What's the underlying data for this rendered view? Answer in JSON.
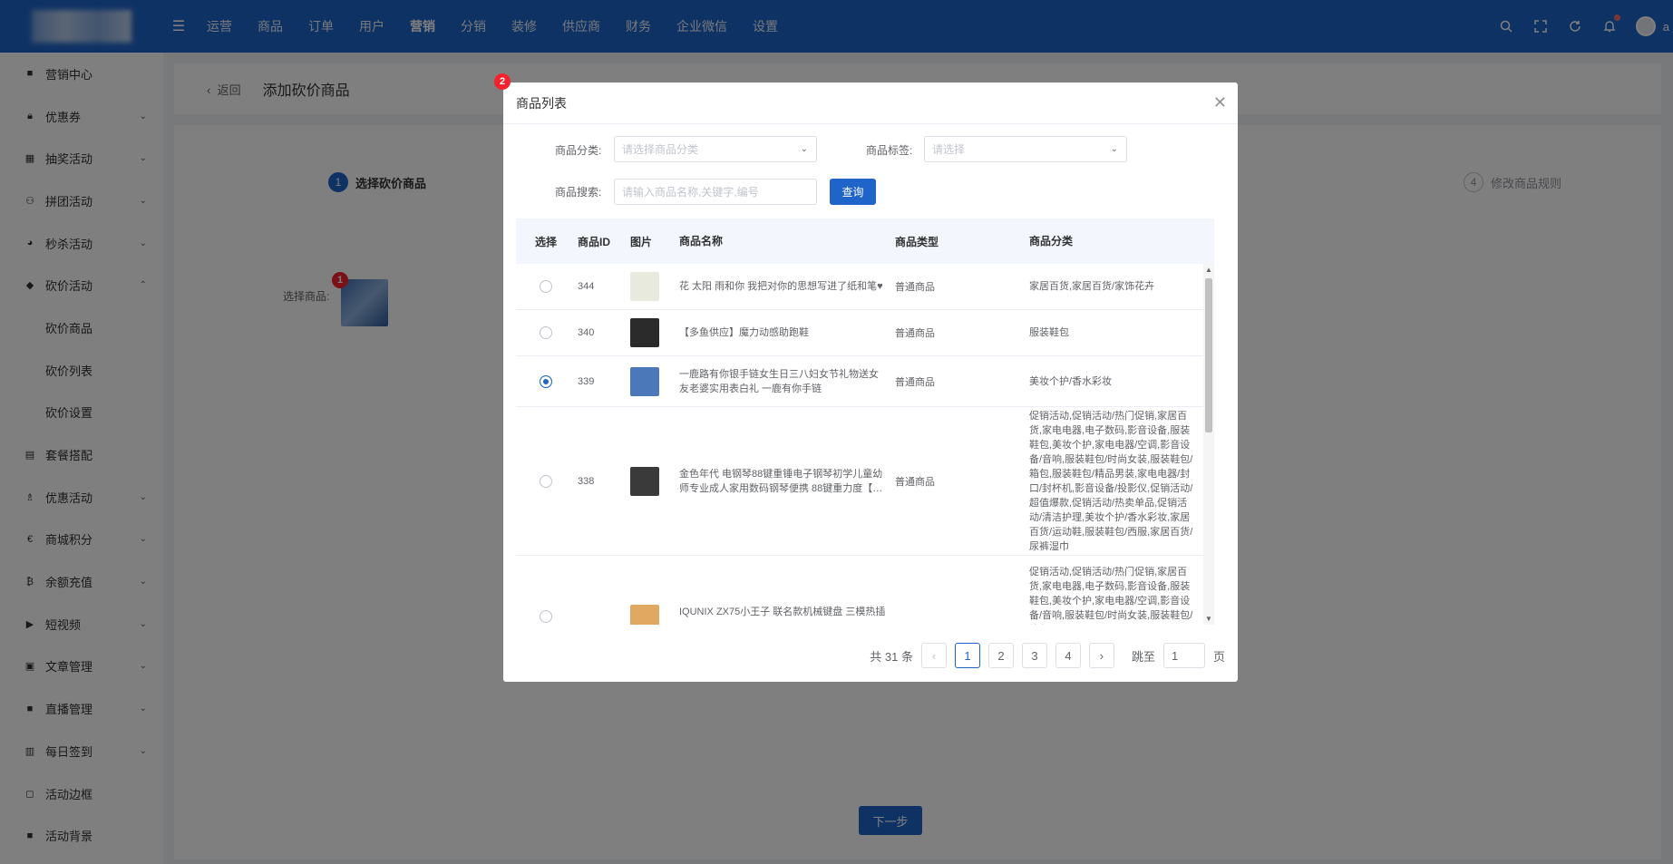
{
  "topbar": {
    "nav": [
      "运营",
      "商品",
      "订单",
      "用户",
      "营销",
      "分销",
      "装修",
      "供应商",
      "财务",
      "企业微信",
      "设置"
    ],
    "active_nav": "营销",
    "user_initial": "a"
  },
  "sidebar": {
    "items": [
      {
        "label": "营销中心",
        "icon": "home-icon"
      },
      {
        "label": "优惠券",
        "icon": "lock-icon"
      },
      {
        "label": "抽奖活动",
        "icon": "grid-icon"
      },
      {
        "label": "拼团活动",
        "icon": "group-icon"
      },
      {
        "label": "秒杀活动",
        "icon": "clock-icon"
      },
      {
        "label": "砍价活动",
        "icon": "tag-icon"
      }
    ],
    "sub_items": [
      "砍价商品",
      "砍价列表",
      "砍价设置"
    ],
    "items_after": [
      {
        "label": "套餐搭配",
        "icon": "package-icon"
      },
      {
        "label": "优惠活动",
        "icon": "gift-icon"
      },
      {
        "label": "商城积分",
        "icon": "euro-icon"
      },
      {
        "label": "余额充值",
        "icon": "bitcoin-icon"
      },
      {
        "label": "短视频",
        "icon": "video-icon"
      },
      {
        "label": "文章管理",
        "icon": "doc-icon"
      },
      {
        "label": "直播管理",
        "icon": "camera-icon"
      },
      {
        "label": "每日签到",
        "icon": "calendar-icon"
      },
      {
        "label": "活动边框",
        "icon": "frame-icon"
      },
      {
        "label": "活动背景",
        "icon": "square-icon"
      }
    ]
  },
  "page": {
    "back": "返回",
    "title": "添加砍价商品",
    "steps": [
      {
        "num": "1",
        "label": "选择砍价商品"
      },
      {
        "num": "4",
        "label": "修改商品规则"
      }
    ],
    "select_label": "选择商品:",
    "badge_1": "1",
    "next": "下一步"
  },
  "modal": {
    "badge": "2",
    "title": "商品列表",
    "filters": {
      "category_label": "商品分类:",
      "category_placeholder": "请选择商品分类",
      "tag_label": "商品标签:",
      "tag_placeholder": "请选择",
      "search_label": "商品搜索:",
      "search_placeholder": "请输入商品名称,关键字,编号",
      "query": "查询"
    },
    "columns": [
      "选择",
      "商品ID",
      "图片",
      "商品名称",
      "商品类型",
      "商品分类"
    ],
    "rows": [
      {
        "id": "344",
        "name": "花 太阳 雨和你 我把对你的思想写进了纸和笔♥",
        "type": "普通商品",
        "category": "家居百货,家居百货/家饰花卉",
        "selected": false,
        "thumb": "#e8eadd"
      },
      {
        "id": "340",
        "name": "【多鱼供应】魔力动感助跑鞋",
        "type": "普通商品",
        "category": "服装鞋包",
        "selected": false,
        "thumb": "#2b2b2b"
      },
      {
        "id": "339",
        "name": "一鹿路有你银手链女生日三八妇女节礼物送女友老婆实用表白礼 一鹿有你手链",
        "type": "普通商品",
        "category": "美妆个护/香水彩妆",
        "selected": true,
        "thumb": "#4a78b8"
      },
      {
        "id": "338",
        "name": "金色年代 电钢琴88键重锤电子钢琴初学儿童幼师专业成人家用数码钢琴便携 88键重力度【…",
        "type": "普通商品",
        "category": "促销活动,促销活动/热门促销,家居百货,家电电器,电子数码,影音设备,服装鞋包,美妆个护,家电电器/空调,影音设备/音响,服装鞋包/时尚女装,服装鞋包/箱包,服装鞋包/精品男装,家电电器/封口/封杯机,影音设备/投影仪,促销活动/超值爆款,促销活动/热卖单品,促销活动/清洁护理,美妆个护/香水彩妆,家居百货/运动鞋,服装鞋包/西服,家居百货/尿裤湿巾",
        "selected": false,
        "thumb": "#3a3a3a"
      },
      {
        "id": "",
        "name": "IQUNIX ZX75小王子 联名款机械键盘 三模热插",
        "type": "",
        "category": "促销活动,促销活动/热门促销,家居百货,家电电器,电子数码,影音设备,服装鞋包,美妆个护,家电电器/空调,影音设备/音响,服装鞋包/时尚女装,服装鞋包/箱包,",
        "selected": false,
        "thumb": "#e0a860"
      }
    ],
    "pager": {
      "total": "共 31 条",
      "pages": [
        "1",
        "2",
        "3",
        "4"
      ],
      "current": "1",
      "jump_label": "跳至",
      "jump_value": "1",
      "page_unit": "页"
    }
  },
  "colors": {
    "primary": "#1f64c9",
    "badge": "#f5222d"
  }
}
